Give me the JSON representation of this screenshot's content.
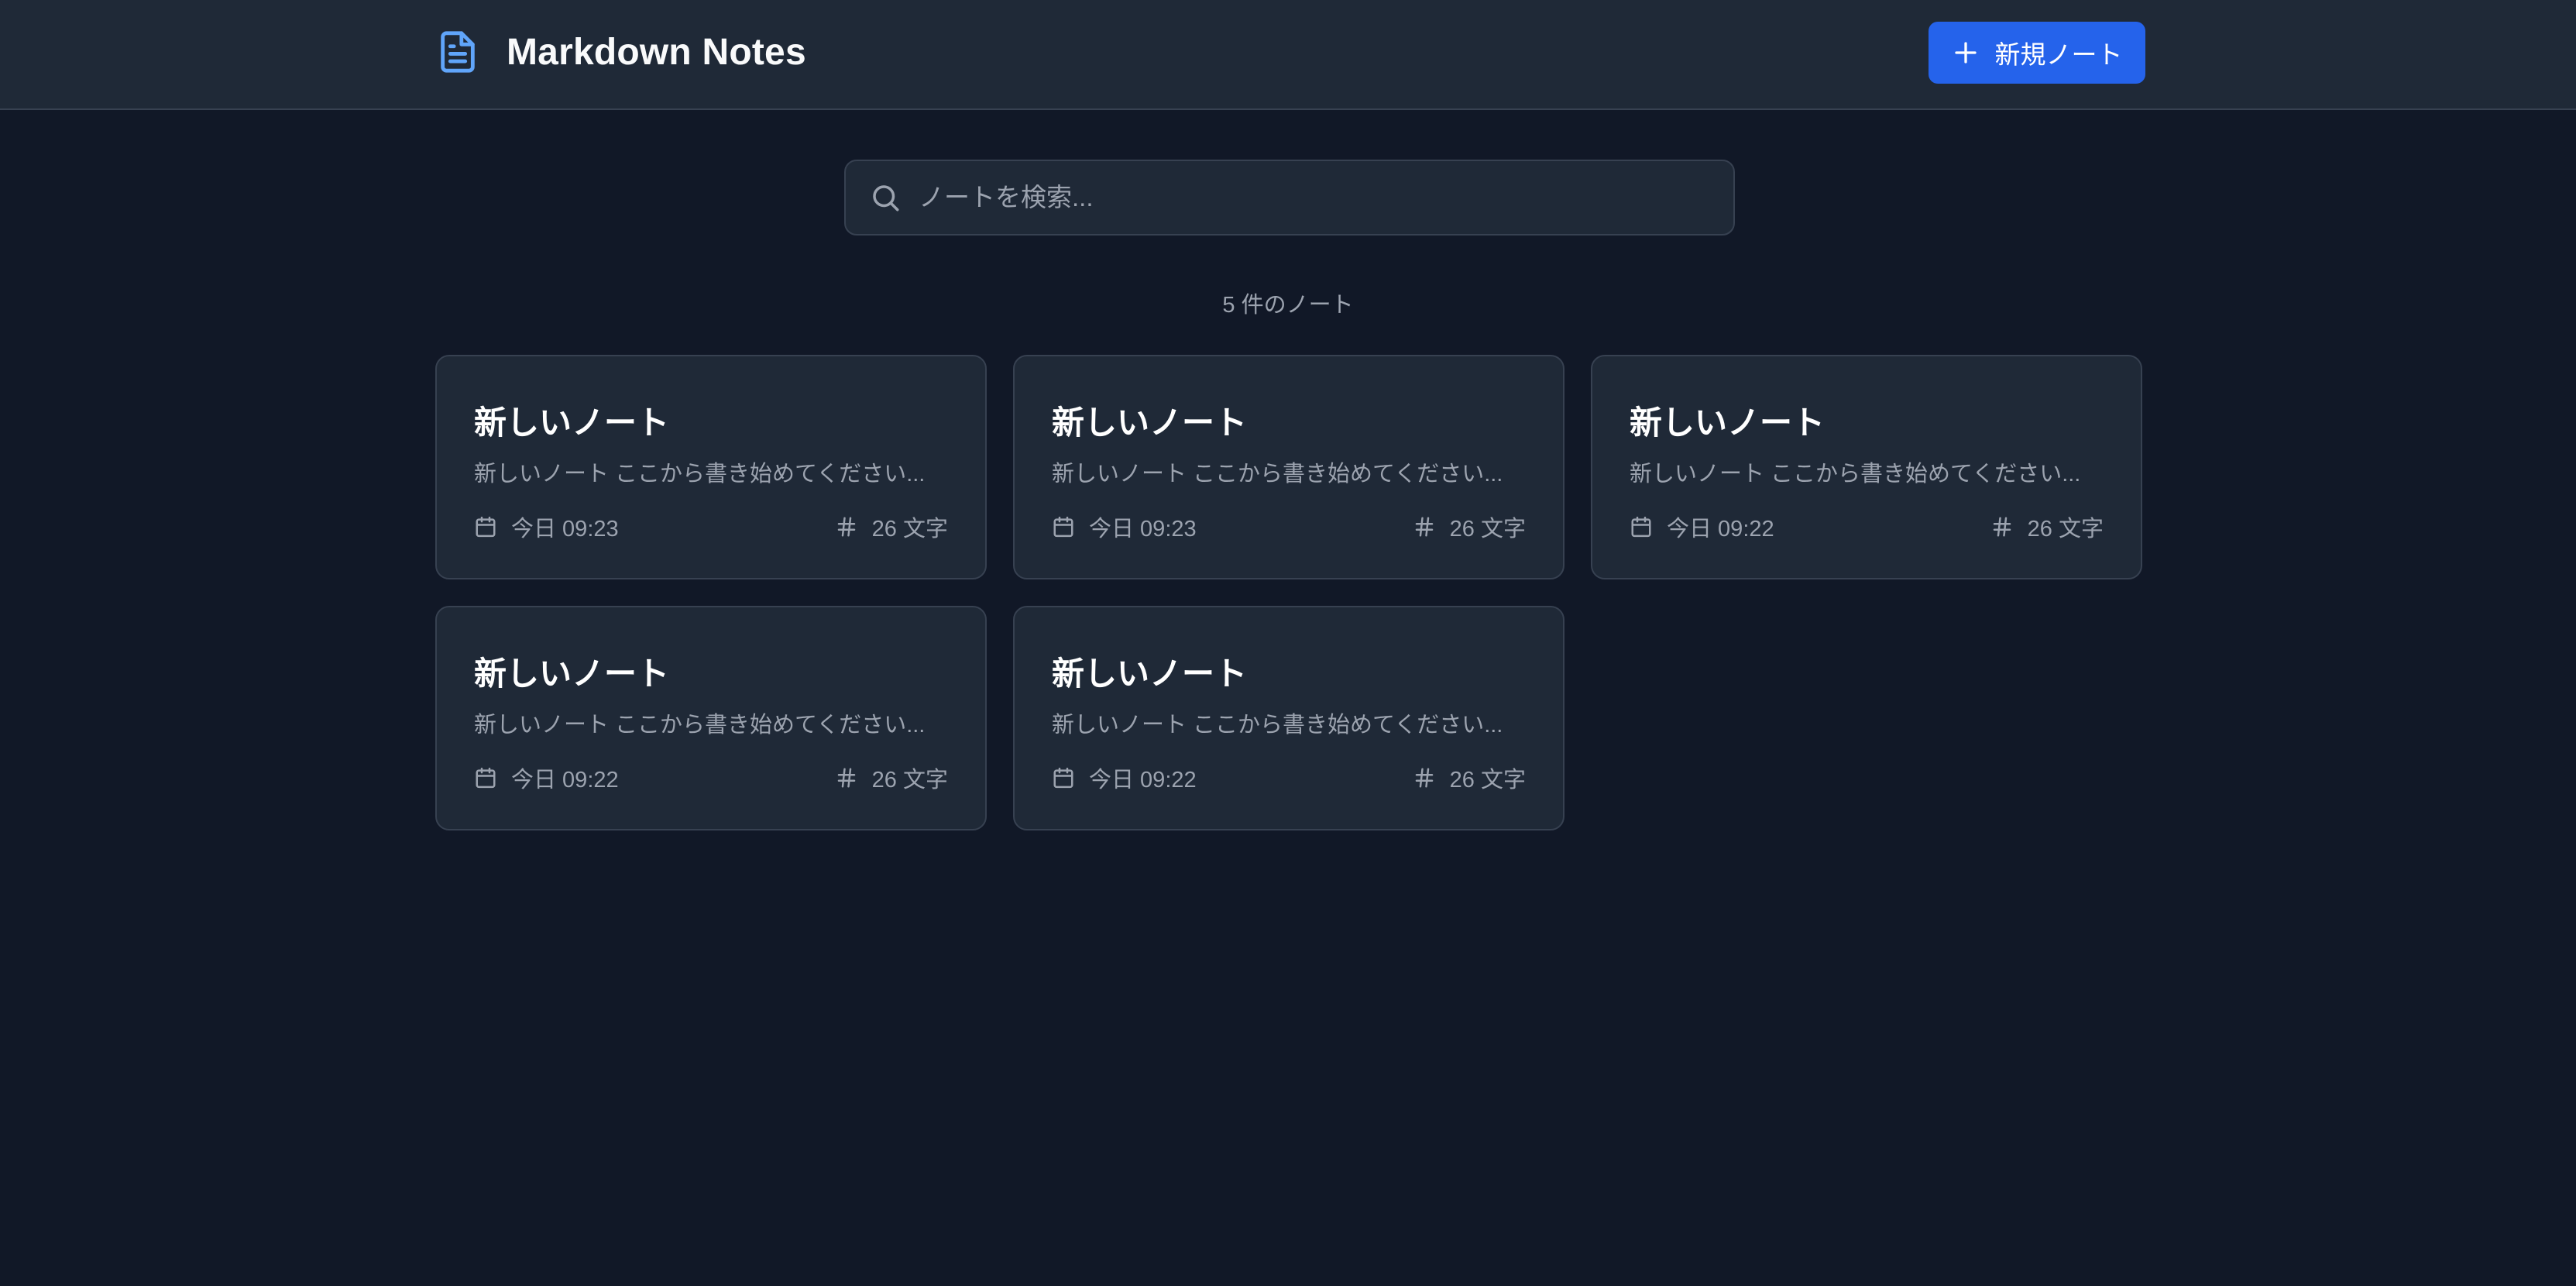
{
  "header": {
    "title": "Markdown Notes",
    "new_note_label": "新規ノート",
    "brand_icon": "file-text-icon",
    "accent": "#2563eb"
  },
  "search": {
    "placeholder": "ノートを検索...",
    "value": ""
  },
  "count_text": "5 件のノート",
  "notes": [
    {
      "title": "新しいノート",
      "preview": "新しいノート ここから書き始めてください...",
      "date": "今日 09:23",
      "chars": "26 文字"
    },
    {
      "title": "新しいノート",
      "preview": "新しいノート ここから書き始めてください...",
      "date": "今日 09:23",
      "chars": "26 文字"
    },
    {
      "title": "新しいノート",
      "preview": "新しいノート ここから書き始めてください...",
      "date": "今日 09:22",
      "chars": "26 文字"
    },
    {
      "title": "新しいノート",
      "preview": "新しいノート ここから書き始めてください...",
      "date": "今日 09:22",
      "chars": "26 文字"
    },
    {
      "title": "新しいノート",
      "preview": "新しいノート ここから書き始めてください...",
      "date": "今日 09:22",
      "chars": "26 文字"
    }
  ]
}
